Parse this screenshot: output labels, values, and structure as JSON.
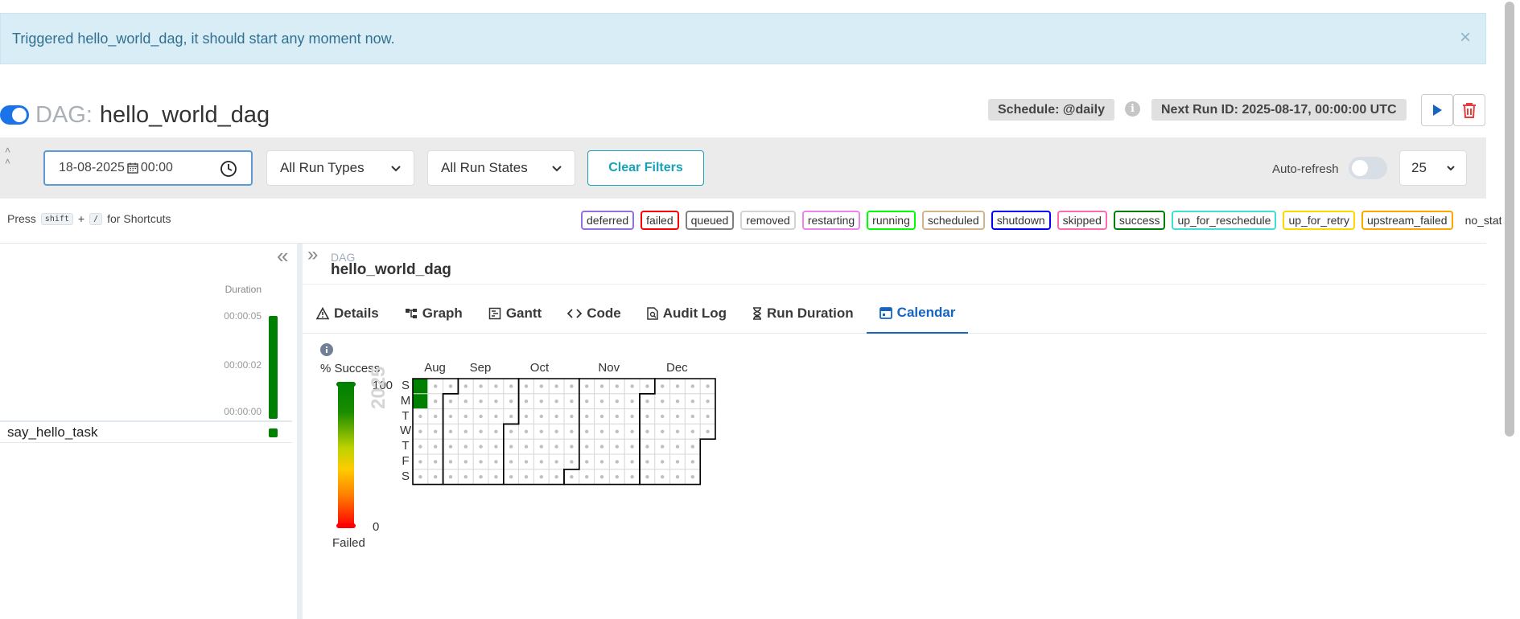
{
  "alert": {
    "message": "Triggered hello_world_dag, it should start any moment now.",
    "close_symbol": "×"
  },
  "header": {
    "dag_prefix": "DAG:",
    "dag_id": "hello_world_dag",
    "schedule": "Schedule: @daily",
    "next_run": "Next Run ID: 2025-08-17, 00:00:00 UTC",
    "info_symbol": "i"
  },
  "filters": {
    "date_value": "18-08-2025",
    "time_value": "00:00",
    "run_types": "All Run Types",
    "run_states": "All Run States",
    "clear": "Clear Filters",
    "auto_refresh": "Auto-refresh",
    "page_size": "25"
  },
  "shortcuts": {
    "press": "Press",
    "key1": "shift",
    "plus": "+",
    "key2": "/",
    "suffix": "for Shortcuts"
  },
  "states": [
    {
      "label": "deferred",
      "color": "#9370db"
    },
    {
      "label": "failed",
      "color": "#ff0000"
    },
    {
      "label": "queued",
      "color": "#808080"
    },
    {
      "label": "removed",
      "color": "#d3d3d3"
    },
    {
      "label": "restarting",
      "color": "#ee82ee"
    },
    {
      "label": "running",
      "color": "#00ff00"
    },
    {
      "label": "scheduled",
      "color": "#d2b48c"
    },
    {
      "label": "shutdown",
      "color": "#0000ff"
    },
    {
      "label": "skipped",
      "color": "#ff69b4"
    },
    {
      "label": "success",
      "color": "#008000"
    },
    {
      "label": "up_for_reschedule",
      "color": "#40e0d0"
    },
    {
      "label": "up_for_retry",
      "color": "#ffd700"
    },
    {
      "label": "upstream_failed",
      "color": "#ffa500"
    },
    {
      "label": "no_status",
      "color": ""
    }
  ],
  "grid": {
    "collapse_symbol": "«",
    "duration_label": "Duration",
    "duration_ticks": [
      "00:00:05",
      "00:00:02",
      "00:00:00"
    ],
    "task": "say_hello_task"
  },
  "details": {
    "expand_symbol": "»",
    "crumb_label": "DAG",
    "crumb_value": "hello_world_dag",
    "tabs": [
      "Details",
      "Graph",
      "Gantt",
      "Code",
      "Audit Log",
      "Run Duration",
      "Calendar"
    ],
    "active_tab": "Calendar"
  },
  "calendar": {
    "legend_title": "% Success",
    "legend_max": "100",
    "legend_min": "0",
    "legend_bottom": "Failed",
    "year": "2025",
    "months": [
      "Aug",
      "Sep",
      "Oct",
      "Nov",
      "Dec"
    ],
    "weekdays": [
      "S",
      "M",
      "T",
      "W",
      "T",
      "F",
      "S"
    ],
    "start_date": "2025-08-17",
    "end_date": "2025-12-31",
    "success_days": [
      "2025-08-17",
      "2025-08-18"
    ],
    "colors": {
      "success": "#008000",
      "empty": "#ffffff",
      "dot": "#bfbfbf"
    }
  },
  "colors": {
    "accent": "#1565c0",
    "alert_bg": "#d9edf7",
    "clear_button": "#17a2b8"
  }
}
